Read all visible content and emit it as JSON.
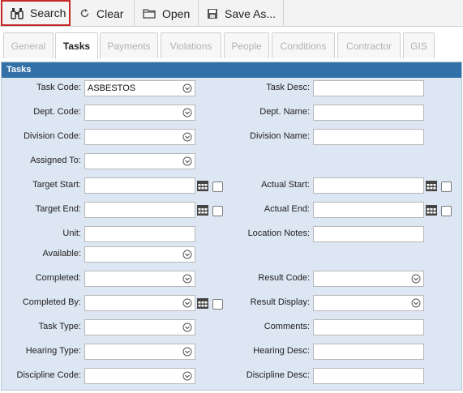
{
  "toolbar": {
    "search_label": "Search",
    "clear_label": "Clear",
    "open_label": "Open",
    "saveas_label": "Save As..."
  },
  "tabs": [
    {
      "label": "General"
    },
    {
      "label": "Tasks"
    },
    {
      "label": "Payments"
    },
    {
      "label": "Violations"
    },
    {
      "label": "People"
    },
    {
      "label": "Conditions"
    },
    {
      "label": "Contractor"
    },
    {
      "label": "GIS"
    }
  ],
  "panel": {
    "title": "Tasks"
  },
  "fields": {
    "task_code": {
      "label": "Task Code:",
      "value": "ASBESTOS"
    },
    "task_desc": {
      "label": "Task Desc:",
      "value": ""
    },
    "dept_code": {
      "label": "Dept. Code:",
      "value": ""
    },
    "dept_name": {
      "label": "Dept. Name:",
      "value": ""
    },
    "division_code": {
      "label": "Division Code:",
      "value": ""
    },
    "division_name": {
      "label": "Division Name:",
      "value": ""
    },
    "assigned_to": {
      "label": "Assigned To:",
      "value": ""
    },
    "target_start": {
      "label": "Target Start:",
      "value": ""
    },
    "actual_start": {
      "label": "Actual Start:",
      "value": ""
    },
    "target_end": {
      "label": "Target End:",
      "value": ""
    },
    "actual_end": {
      "label": "Actual End:",
      "value": ""
    },
    "unit": {
      "label": "Unit:",
      "value": ""
    },
    "location_notes": {
      "label": "Location Notes:",
      "value": ""
    },
    "available": {
      "label": "Available:",
      "value": ""
    },
    "completed": {
      "label": "Completed:",
      "value": ""
    },
    "result_code": {
      "label": "Result Code:",
      "value": ""
    },
    "completed_by": {
      "label": "Completed By:",
      "value": ""
    },
    "result_display": {
      "label": "Result Display:",
      "value": ""
    },
    "task_type": {
      "label": "Task Type:",
      "value": ""
    },
    "comments": {
      "label": "Comments:",
      "value": ""
    },
    "hearing_type": {
      "label": "Hearing Type:",
      "value": ""
    },
    "hearing_desc": {
      "label": "Hearing Desc:",
      "value": ""
    },
    "discipline_code": {
      "label": "Discipline Code:",
      "value": ""
    },
    "discipline_desc": {
      "label": "Discipline Desc:",
      "value": ""
    }
  },
  "icons": {
    "search": "binoculars-icon",
    "clear": "refresh-icon",
    "open": "folder-icon",
    "saveas": "floppy-disk-icon",
    "dropdown": "chevron-down-circle-icon",
    "calendar": "calendar-icon"
  },
  "colors": {
    "panel_header": "#3470a8",
    "panel_bg": "#dde6f3",
    "search_outline": "#c62828"
  }
}
